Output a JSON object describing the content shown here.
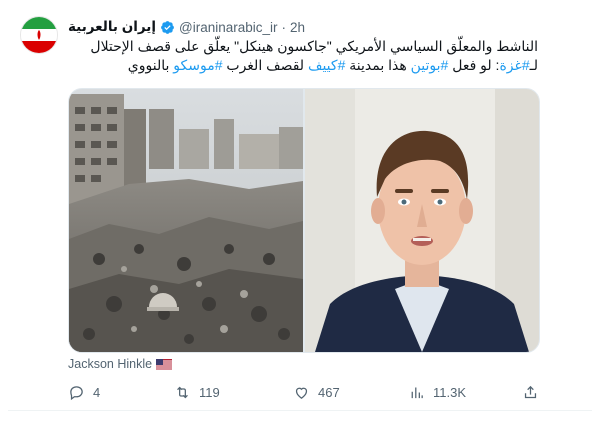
{
  "post": {
    "display_name": "إيران بالعربية",
    "handle": "@iraninarabic_ir",
    "separator": "·",
    "time": "2h",
    "text_parts": {
      "line1": "الناشط والمعلّق السياسي الأمريكي \"جاكسون هينكل\" يعلّق على قصف الإحتلال لـ",
      "hashtag_gaza": "#غزة",
      "part2": ": لو فعل ",
      "hashtag_putin": "#بوتين",
      "part3": " هذا بمدينة ",
      "hashtag_kyiv": "#كييف",
      "part4": " لقصف الغرب ",
      "hashtag_moscow": "#موسكو",
      "part5": " بالنووي"
    },
    "media_caption": "Jackson Hinkle"
  },
  "metrics": {
    "replies": "4",
    "reposts": "119",
    "likes": "467",
    "views": "11.3K"
  },
  "icons": {
    "avatar": "iran-flag-avatar",
    "verified": "verified-badge-icon",
    "reply": "reply-icon",
    "repost": "repost-icon",
    "like": "heart-icon",
    "views": "views-chart-icon",
    "share": "share-icon",
    "caption_flag": "us-flag-icon"
  },
  "colors": {
    "accent": "#1d9bf0",
    "muted": "#536471",
    "text": "#0f1419"
  }
}
